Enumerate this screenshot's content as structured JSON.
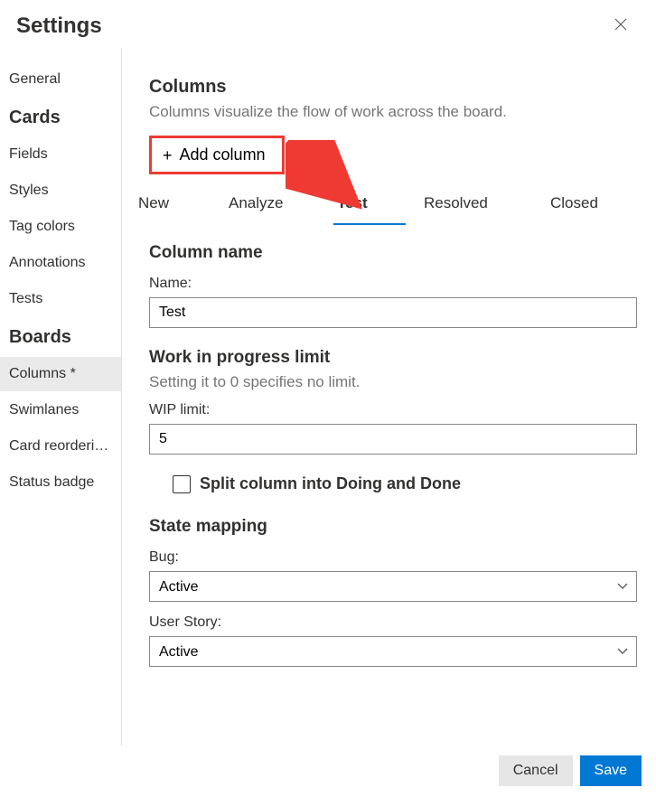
{
  "header": {
    "title": "Settings"
  },
  "sidebar": {
    "groups": [
      {
        "items": [
          {
            "label": "General"
          }
        ]
      },
      {
        "title": "Cards",
        "items": [
          {
            "label": "Fields"
          },
          {
            "label": "Styles"
          },
          {
            "label": "Tag colors"
          },
          {
            "label": "Annotations"
          },
          {
            "label": "Tests"
          }
        ]
      },
      {
        "title": "Boards",
        "items": [
          {
            "label": "Columns *",
            "selected": true
          },
          {
            "label": "Swimlanes"
          },
          {
            "label": "Card reorderi…"
          },
          {
            "label": "Status badge"
          }
        ]
      }
    ]
  },
  "main": {
    "columns_title": "Columns",
    "columns_sub": "Columns visualize the flow of work across the board.",
    "add_column_label": "Add column",
    "tabs": [
      {
        "label": "New"
      },
      {
        "label": "Analyze"
      },
      {
        "label": "Test",
        "active": true
      },
      {
        "label": "Resolved"
      },
      {
        "label": "Closed"
      }
    ],
    "column_name_section": "Column name",
    "name_label": "Name:",
    "name_value": "Test",
    "wip_section": "Work in progress limit",
    "wip_hint": "Setting it to 0 specifies no limit.",
    "wip_label": "WIP limit:",
    "wip_value": "5",
    "split_label": "Split column into Doing and Done",
    "state_mapping_section": "State mapping",
    "bug_label": "Bug:",
    "bug_value": "Active",
    "user_story_label": "User Story:",
    "user_story_value": "Active"
  },
  "footer": {
    "cancel": "Cancel",
    "save": "Save"
  }
}
